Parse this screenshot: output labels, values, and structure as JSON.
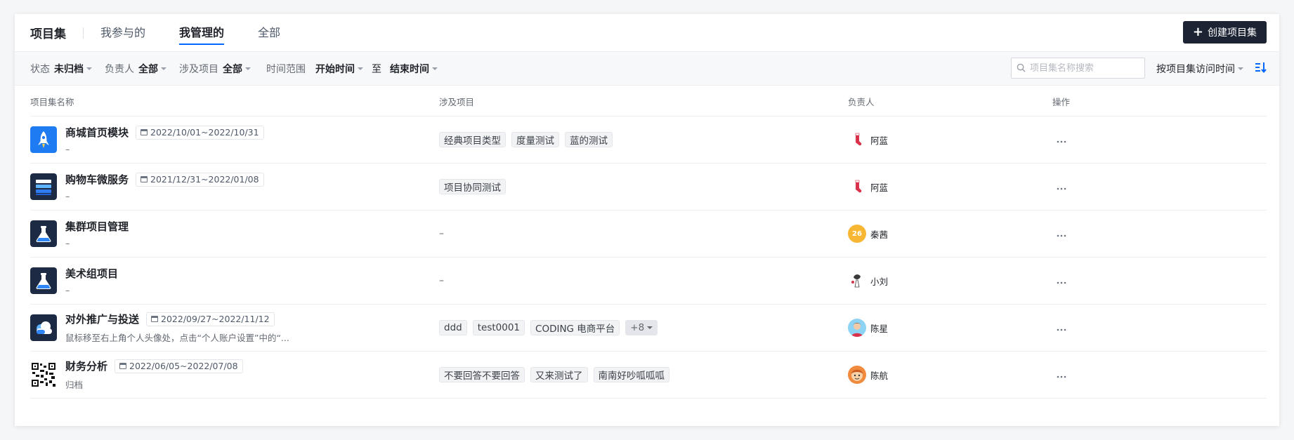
{
  "header": {
    "title": "项目集",
    "tabs": [
      {
        "label": "我参与的",
        "active": false
      },
      {
        "label": "我管理的",
        "active": true
      },
      {
        "label": "全部",
        "active": false
      }
    ],
    "create_button": "创建项目集"
  },
  "filters": {
    "status_label": "状态",
    "status_value": "未归档",
    "owner_label": "负责人",
    "owner_value": "全部",
    "project_label": "涉及项目",
    "project_value": "全部",
    "time_label": "时间范围",
    "start_value": "开始时间",
    "to_text": "至",
    "end_value": "结束时间",
    "search_placeholder": "项目集名称搜索",
    "sort_value": "按项目集访问时间"
  },
  "columns": [
    "项目集名称",
    "涉及项目",
    "负责人",
    "操作"
  ],
  "rows": [
    {
      "name": "商城首页模块",
      "date": "2022/10/01~2022/10/31",
      "desc": "–",
      "projects": [
        "经典项目类型",
        "度量测试",
        "蓝的测试"
      ],
      "owner": "阿蓝"
    },
    {
      "name": "购物车微服务",
      "date": "2021/12/31~2022/01/08",
      "desc": "–",
      "projects": [
        "项目协同测试"
      ],
      "owner": "阿蓝"
    },
    {
      "name": "集群项目管理",
      "date": "",
      "desc": "–",
      "projects": [],
      "projects_empty": "–",
      "owner": "秦茜",
      "owner_badge": "26"
    },
    {
      "name": "美术组项目",
      "date": "",
      "desc": "–",
      "projects": [],
      "projects_empty": "–",
      "owner": "小刘"
    },
    {
      "name": "对外推广与投送",
      "date": "2022/09/27~2022/11/12",
      "desc": "鼠标移至右上角个人头像处，点击“个人账户设置”中的“...",
      "projects": [
        "ddd",
        "test0001",
        "CODING 电商平台"
      ],
      "more": "+8",
      "owner": "陈星"
    },
    {
      "name": "财务分析",
      "date": "2022/06/05~2022/07/08",
      "desc": "归档",
      "projects": [
        "不要回答不要回答",
        "又来测试了",
        "南南好吵呱呱呱"
      ],
      "owner": "陈航"
    }
  ],
  "colors": {
    "accent": "#0066ff",
    "button": "#1c2333",
    "badge": "#f7b733"
  }
}
